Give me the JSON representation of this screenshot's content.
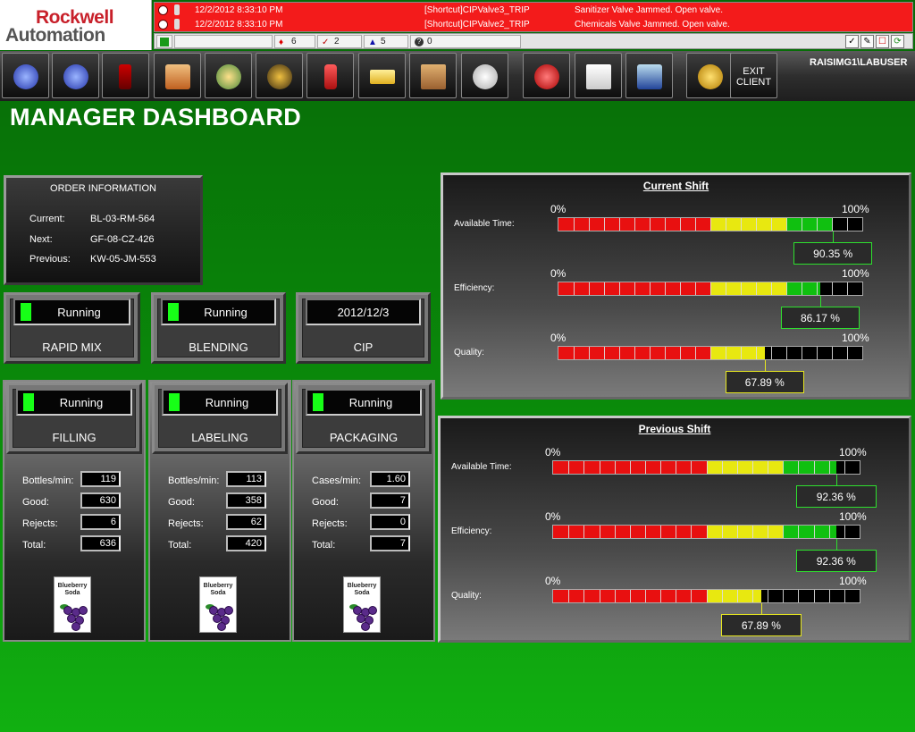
{
  "brand": {
    "line1": "Rockwell",
    "line2": "Automation"
  },
  "alarms": [
    {
      "time": "12/2/2012 8:33:10 PM",
      "tag": "[Shortcut]CIPValve3_TRIP",
      "message": "Sanitizer Valve Jammed.  Open valve."
    },
    {
      "time": "12/2/2012 8:33:10 PM",
      "tag": "[Shortcut]CIPValve2_TRIP",
      "message": "Chemicals Valve Jammed.  Open valve."
    }
  ],
  "status_counts": {
    "a": "6",
    "b": "2",
    "c": "5",
    "d": "0"
  },
  "toolbar": {
    "exit_line1": "EXIT",
    "exit_line2": "CLIENT",
    "user": "RAISIMG1\\LABUSER"
  },
  "page_title": "MANAGER DASHBOARD",
  "order": {
    "title": "ORDER INFORMATION",
    "rows": [
      {
        "label": "Current:",
        "value": "BL-03-RM-564"
      },
      {
        "label": "Next:",
        "value": "GF-08-CZ-426"
      },
      {
        "label": "Previous:",
        "value": "KW-05-JM-553"
      }
    ]
  },
  "tiles_top": [
    {
      "status": "Running",
      "name": "RAPID MIX",
      "led": true
    },
    {
      "status": "Running",
      "name": "BLENDING",
      "led": true
    },
    {
      "status": "2012/12/3",
      "name": "CIP",
      "led": false
    }
  ],
  "columns": [
    {
      "status": "Running",
      "name": "FILLING",
      "rate_label": "Bottles/min:",
      "rate": "119",
      "good": "630",
      "rejects": "6",
      "total": "636",
      "product_line1": "Blueberry",
      "product_line2": "Soda"
    },
    {
      "status": "Running",
      "name": "LABELING",
      "rate_label": "Bottles/min:",
      "rate": "113",
      "good": "358",
      "rejects": "62",
      "total": "420",
      "product_line1": "Blueberry",
      "product_line2": "Soda"
    },
    {
      "status": "Running",
      "name": "PACKAGING",
      "rate_label": "Cases/min:",
      "rate": "1.60",
      "good": "7",
      "rejects": "0",
      "total": "7",
      "product_line1": "Blueberry",
      "product_line2": "Soda"
    }
  ],
  "metric_labels": {
    "good": "Good:",
    "rejects": "Rejects:",
    "total": "Total:"
  },
  "scale": {
    "min": "0%",
    "max": "100%"
  },
  "shifts": [
    {
      "title": "Current Shift",
      "metrics": [
        {
          "label": "Available Time:",
          "value": 90.35,
          "display": "90.35  %"
        },
        {
          "label": "Efficiency:",
          "value": 86.17,
          "display": "86.17  %"
        },
        {
          "label": "Quality:",
          "value": 67.89,
          "display": "67.89  %"
        }
      ]
    },
    {
      "title": "Previous Shift",
      "metrics": [
        {
          "label": "Available Time:",
          "value": 92.36,
          "display": "92.36  %"
        },
        {
          "label": "Efficiency:",
          "value": 92.36,
          "display": "92.36  %"
        },
        {
          "label": "Quality:",
          "value": 67.89,
          "display": "67.89  %"
        }
      ]
    }
  ],
  "colors": {
    "red": "#e81010",
    "yellow": "#e8e810",
    "green": "#10c010",
    "box_green": "#2ee02e",
    "box_yellow": "#e8e820"
  }
}
